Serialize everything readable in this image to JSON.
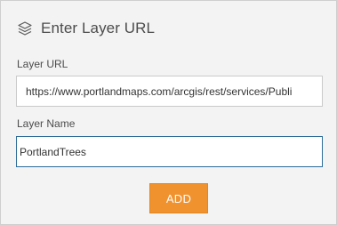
{
  "header": {
    "icon": "layers-icon",
    "title": "Enter Layer URL"
  },
  "form": {
    "url_label": "Layer URL",
    "url_value": "https://www.portlandmaps.com/arcgis/rest/services/Publi",
    "name_label": "Layer Name",
    "name_value": "PortlandTrees",
    "add_label": "ADD"
  },
  "colors": {
    "panel_bg": "#f3f3f3",
    "button_bg": "#f0922e",
    "focus_border": "#2d6c98",
    "text": "#4c4c4c"
  }
}
